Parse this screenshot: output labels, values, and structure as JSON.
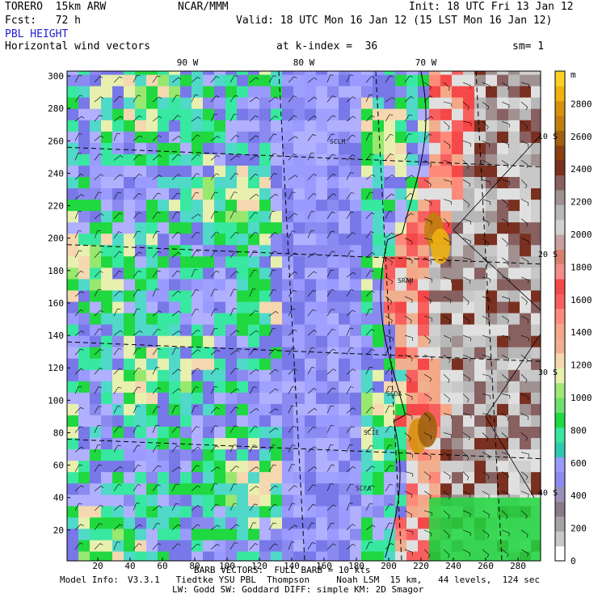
{
  "header": {
    "model": "TORERO  15km ARW",
    "center": "NCAR/MMM",
    "init": "Init: 18 UTC Fri 13 Jan 12",
    "fcst": "Fcst:   72 h",
    "valid": "Valid: 18 UTC Mon 16 Jan 12 (15 LST Mon 16 Jan 12)",
    "field_name": "PBL HEIGHT",
    "field_color": "#1f1fcf",
    "overlay": "Horizontal wind vectors",
    "level": "at k-index =  36",
    "smooth": "sm= 1"
  },
  "footer": {
    "line1": "BARB VECTORS:  FULL BARB = 10 kts",
    "model_info_label": "Model Info:",
    "model_info": "V3.3.1   Tiedtke YSU PBL  Thompson     Noah LSM  15 km,   44 levels,  124 sec",
    "line3": "LW: Godd SW: Goddard DIFF: simple KM: 2D Smagor"
  },
  "chart_data": {
    "type": "heatmap",
    "title": "PBL HEIGHT",
    "xlabel": "",
    "ylabel": "",
    "xlim": [
      1,
      294
    ],
    "ylim": [
      1,
      303
    ],
    "x_ticks": [
      20,
      40,
      60,
      80,
      100,
      120,
      140,
      160,
      180,
      200,
      220,
      240,
      260,
      280
    ],
    "y_ticks": [
      20,
      40,
      60,
      80,
      100,
      120,
      140,
      160,
      180,
      200,
      220,
      240,
      260,
      280,
      300
    ],
    "lon_labels": [
      "90 W",
      "80 W",
      "70 W"
    ],
    "lat_labels": [
      "10 S",
      "20 S",
      "30 S",
      "40 S"
    ],
    "city_labels": [
      "SCLM",
      "SRAM",
      "SCDA",
      "SCIE",
      "SCFA"
    ],
    "colorbar": {
      "unit": "m",
      "levels": [
        0,
        200,
        400,
        600,
        800,
        1000,
        1200,
        1400,
        1600,
        1800,
        2000,
        2200,
        2400,
        2600,
        2800
      ],
      "colors": [
        "#ffffff",
        "#c8c8c8",
        "#a4a4a4",
        "#8a7a8a",
        "#9a90b8",
        "#8a8af0",
        "#9a9aff",
        "#30c8b0",
        "#38e8a0",
        "#20d840",
        "#70e070",
        "#a0e878",
        "#e8f0b0",
        "#f5d8b0",
        "#f0b090",
        "#f4a888",
        "#ff8a7a",
        "#f86060",
        "#f54848",
        "#f48c8c",
        "#d88070",
        "#c8a0a0",
        "#d0d0d0",
        "#b8b8b8",
        "#a09090",
        "#886060",
        "#7a3020",
        "#8a4010",
        "#a06010",
        "#c08010",
        "#d89010",
        "#f0b010",
        "#ffd020"
      ]
    },
    "barb_label": "BARB VECTORS:  FULL BARB = 10 kts"
  }
}
